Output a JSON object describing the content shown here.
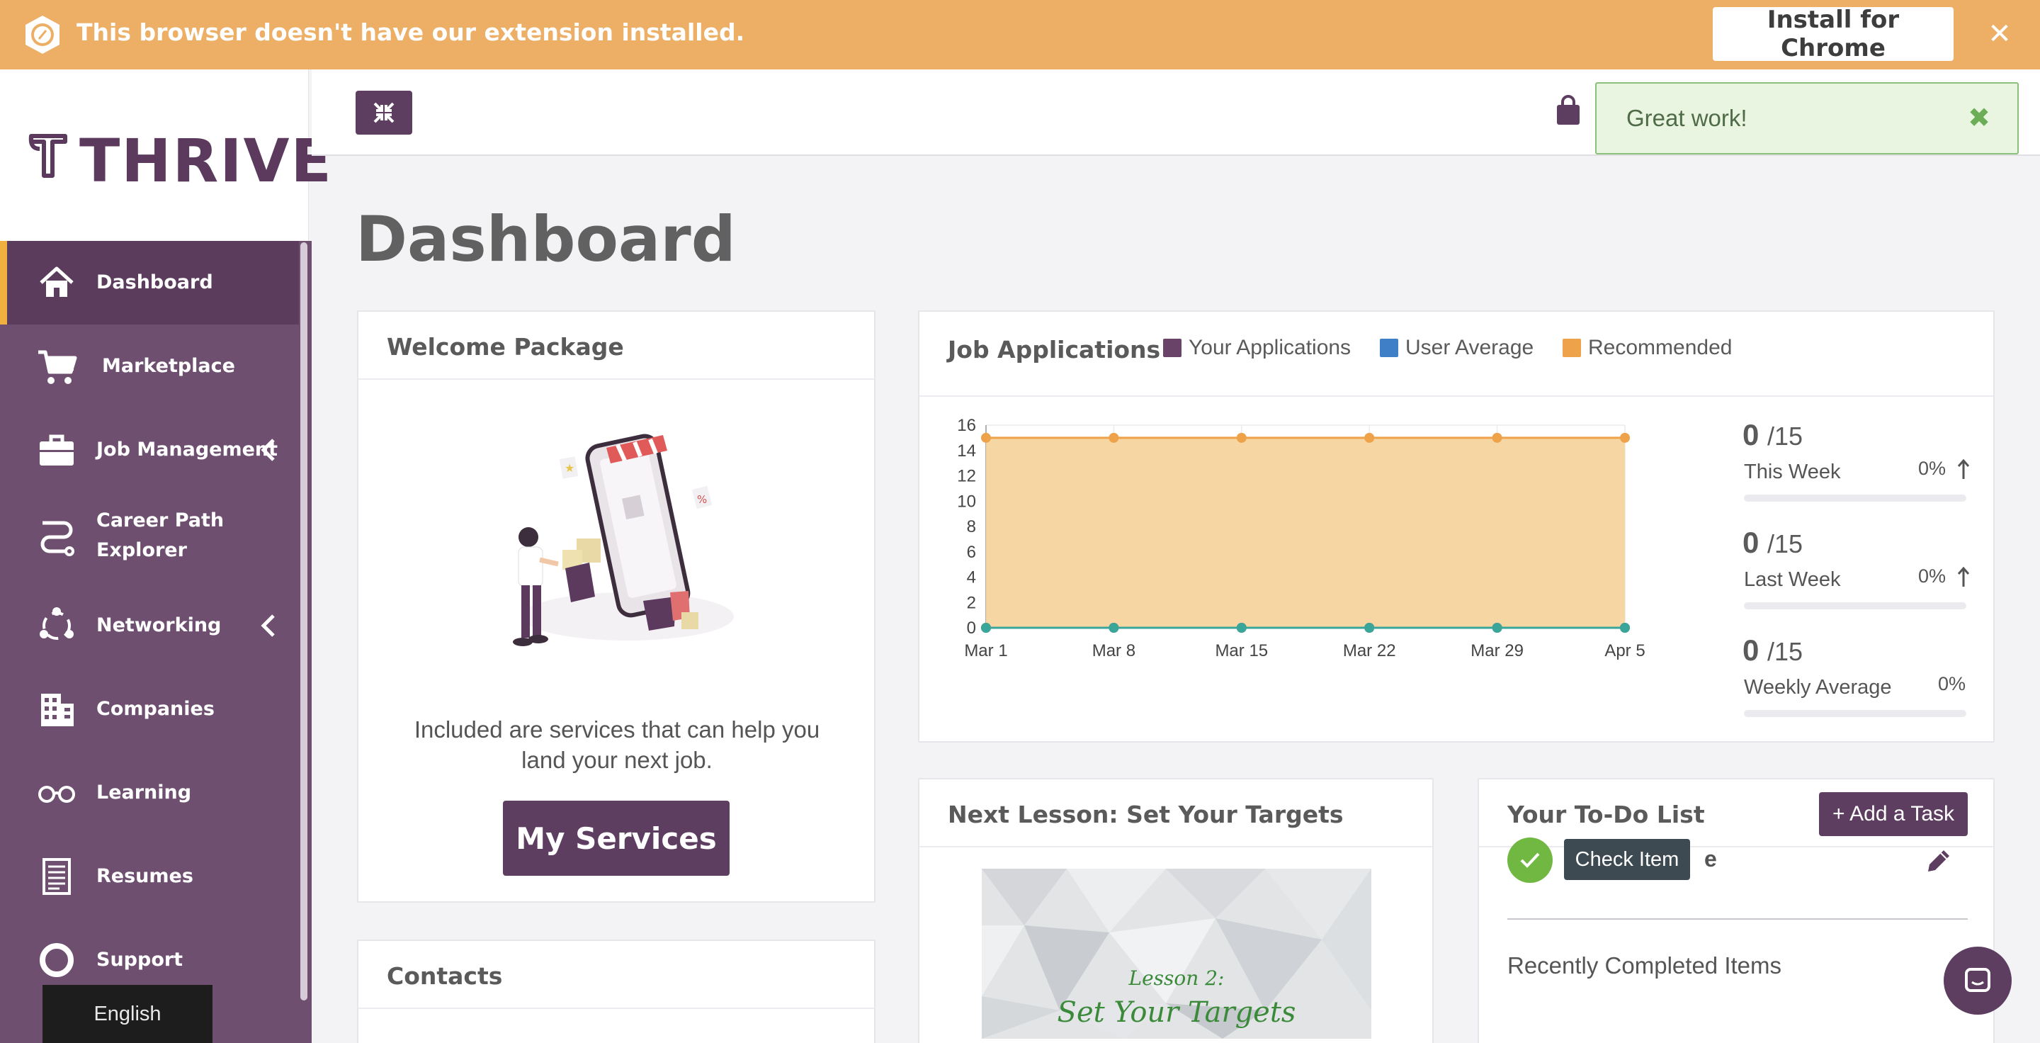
{
  "extension_banner": {
    "message": "This browser doesn't have our extension installed.",
    "install_label": "Install for Chrome",
    "close_glyph": "✕"
  },
  "brand": {
    "name": "THRIVE",
    "accent": "#5e3e60",
    "highlight": "#f0b03f"
  },
  "sidebar": {
    "items": [
      {
        "label": "Dashboard",
        "icon": "home-icon",
        "active": true
      },
      {
        "label": "Marketplace",
        "icon": "cart-icon"
      },
      {
        "label": "Job Management",
        "icon": "briefcase-icon",
        "has_submenu": true
      },
      {
        "label_line1": "Career Path",
        "label_line2": "Explorer",
        "icon": "path-icon"
      },
      {
        "label": "Networking",
        "icon": "network-icon",
        "has_submenu": true
      },
      {
        "label": "Companies",
        "icon": "building-icon"
      },
      {
        "label": "Learning",
        "icon": "glasses-icon"
      },
      {
        "label": "Resumes",
        "icon": "document-icon"
      },
      {
        "label": "Support",
        "icon": "lifebuoy-icon"
      }
    ],
    "language": "English"
  },
  "toast": {
    "message": "Great work!",
    "close_glyph": "✖"
  },
  "page": {
    "title": "Dashboard"
  },
  "welcome": {
    "title": "Welcome Package",
    "text": "Included are services that can help you land your next job.",
    "button_label": "My Services"
  },
  "job_applications": {
    "title": "Job Applications",
    "legend": [
      {
        "label": "Your Applications",
        "color": "#6a4468"
      },
      {
        "label": "User Average",
        "color": "#3f7fc8"
      },
      {
        "label": "Recommended",
        "color": "#eea24a"
      }
    ],
    "stats": [
      {
        "value": "0",
        "denominator": "/15",
        "label": "This Week",
        "percent": "0%",
        "trend": "up"
      },
      {
        "value": "0",
        "denominator": "/15",
        "label": "Last Week",
        "percent": "0%",
        "trend": "up"
      },
      {
        "value": "0",
        "denominator": "/15",
        "label": "Weekly Average",
        "percent": "0%",
        "trend": "none"
      }
    ]
  },
  "chart_data": {
    "type": "area",
    "x": [
      "Mar 1",
      "Mar 8",
      "Mar 15",
      "Mar 22",
      "Mar 29",
      "Apr 5"
    ],
    "ylim": [
      0,
      16
    ],
    "yticks": [
      0,
      2,
      4,
      6,
      8,
      10,
      12,
      14,
      16
    ],
    "series": [
      {
        "name": "Your Applications",
        "values": [
          0,
          0,
          0,
          0,
          0,
          0
        ],
        "color": "#6a4468"
      },
      {
        "name": "User Average",
        "values": [
          0,
          0,
          0,
          0,
          0,
          0
        ],
        "color": "#3aa69a"
      },
      {
        "name": "Recommended",
        "values": [
          15,
          15,
          15,
          15,
          15,
          15
        ],
        "color": "#eea24a"
      }
    ],
    "grid": true
  },
  "next_lesson": {
    "title": "Next Lesson: Set Your Targets",
    "thumb_line1": "Lesson 2:",
    "thumb_line2": "Set Your Targets"
  },
  "todo": {
    "title": "Your To-Do List",
    "add_label": "+ Add a Task",
    "item_partial": "e",
    "tooltip": "Check Item",
    "recent_title": "Recently Completed Items"
  },
  "contacts": {
    "title": "Contacts"
  }
}
